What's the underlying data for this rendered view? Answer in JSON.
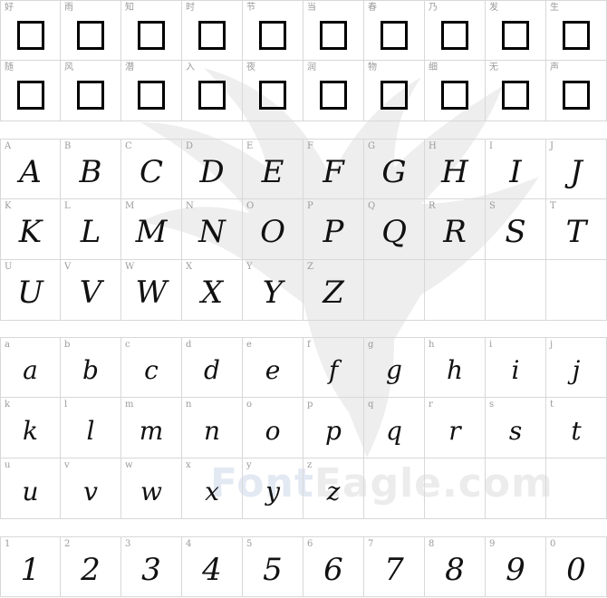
{
  "watermark": {
    "brand_part1": "Font",
    "brand_part2": "Eagle.com"
  },
  "sections": [
    {
      "id": "cjk",
      "cells": [
        {
          "label": "好",
          "glyph": "□"
        },
        {
          "label": "雨",
          "glyph": "□"
        },
        {
          "label": "知",
          "glyph": "□"
        },
        {
          "label": "时",
          "glyph": "□"
        },
        {
          "label": "节",
          "glyph": "□"
        },
        {
          "label": "当",
          "glyph": "□"
        },
        {
          "label": "春",
          "glyph": "□"
        },
        {
          "label": "乃",
          "glyph": "□"
        },
        {
          "label": "发",
          "glyph": "□"
        },
        {
          "label": "生",
          "glyph": "□"
        },
        {
          "label": "随",
          "glyph": "□"
        },
        {
          "label": "风",
          "glyph": "□"
        },
        {
          "label": "潜",
          "glyph": "□"
        },
        {
          "label": "入",
          "glyph": "□"
        },
        {
          "label": "夜",
          "glyph": "□"
        },
        {
          "label": "润",
          "glyph": "□"
        },
        {
          "label": "物",
          "glyph": "□"
        },
        {
          "label": "细",
          "glyph": "□"
        },
        {
          "label": "无",
          "glyph": "□"
        },
        {
          "label": "声",
          "glyph": "□"
        }
      ]
    },
    {
      "id": "uppercase",
      "cells": [
        {
          "label": "A",
          "glyph": "A"
        },
        {
          "label": "B",
          "glyph": "B"
        },
        {
          "label": "C",
          "glyph": "C"
        },
        {
          "label": "D",
          "glyph": "D"
        },
        {
          "label": "E",
          "glyph": "E"
        },
        {
          "label": "F",
          "glyph": "F"
        },
        {
          "label": "G",
          "glyph": "G"
        },
        {
          "label": "H",
          "glyph": "H"
        },
        {
          "label": "I",
          "glyph": "I"
        },
        {
          "label": "J",
          "glyph": "J"
        },
        {
          "label": "K",
          "glyph": "K"
        },
        {
          "label": "L",
          "glyph": "L"
        },
        {
          "label": "M",
          "glyph": "M"
        },
        {
          "label": "N",
          "glyph": "N"
        },
        {
          "label": "O",
          "glyph": "O"
        },
        {
          "label": "P",
          "glyph": "P"
        },
        {
          "label": "Q",
          "glyph": "Q"
        },
        {
          "label": "R",
          "glyph": "R"
        },
        {
          "label": "S",
          "glyph": "S"
        },
        {
          "label": "T",
          "glyph": "T"
        },
        {
          "label": "U",
          "glyph": "U"
        },
        {
          "label": "V",
          "glyph": "V"
        },
        {
          "label": "W",
          "glyph": "W"
        },
        {
          "label": "X",
          "glyph": "X"
        },
        {
          "label": "Y",
          "glyph": "Y"
        },
        {
          "label": "Z",
          "glyph": "Z"
        },
        {
          "label": "",
          "glyph": ""
        },
        {
          "label": "",
          "glyph": ""
        },
        {
          "label": "",
          "glyph": ""
        },
        {
          "label": "",
          "glyph": ""
        }
      ]
    },
    {
      "id": "lowercase",
      "cells": [
        {
          "label": "a",
          "glyph": "a"
        },
        {
          "label": "b",
          "glyph": "b"
        },
        {
          "label": "c",
          "glyph": "c"
        },
        {
          "label": "d",
          "glyph": "d"
        },
        {
          "label": "e",
          "glyph": "e"
        },
        {
          "label": "f",
          "glyph": "f"
        },
        {
          "label": "g",
          "glyph": "g"
        },
        {
          "label": "h",
          "glyph": "h"
        },
        {
          "label": "i",
          "glyph": "i"
        },
        {
          "label": "j",
          "glyph": "j"
        },
        {
          "label": "k",
          "glyph": "k"
        },
        {
          "label": "l",
          "glyph": "l"
        },
        {
          "label": "m",
          "glyph": "m"
        },
        {
          "label": "n",
          "glyph": "n"
        },
        {
          "label": "o",
          "glyph": "o"
        },
        {
          "label": "p",
          "glyph": "p"
        },
        {
          "label": "q",
          "glyph": "q"
        },
        {
          "label": "r",
          "glyph": "r"
        },
        {
          "label": "s",
          "glyph": "s"
        },
        {
          "label": "t",
          "glyph": "t"
        },
        {
          "label": "u",
          "glyph": "u"
        },
        {
          "label": "v",
          "glyph": "v"
        },
        {
          "label": "w",
          "glyph": "w"
        },
        {
          "label": "x",
          "glyph": "x"
        },
        {
          "label": "y",
          "glyph": "y"
        },
        {
          "label": "z",
          "glyph": "z"
        },
        {
          "label": "",
          "glyph": ""
        },
        {
          "label": "",
          "glyph": ""
        },
        {
          "label": "",
          "glyph": ""
        },
        {
          "label": "",
          "glyph": ""
        }
      ]
    },
    {
      "id": "digits",
      "cells": [
        {
          "label": "1",
          "glyph": "1"
        },
        {
          "label": "2",
          "glyph": "2"
        },
        {
          "label": "3",
          "glyph": "3"
        },
        {
          "label": "4",
          "glyph": "4"
        },
        {
          "label": "5",
          "glyph": "5"
        },
        {
          "label": "6",
          "glyph": "6"
        },
        {
          "label": "7",
          "glyph": "7"
        },
        {
          "label": "8",
          "glyph": "8"
        },
        {
          "label": "9",
          "glyph": "9"
        },
        {
          "label": "0",
          "glyph": "0"
        }
      ]
    }
  ]
}
